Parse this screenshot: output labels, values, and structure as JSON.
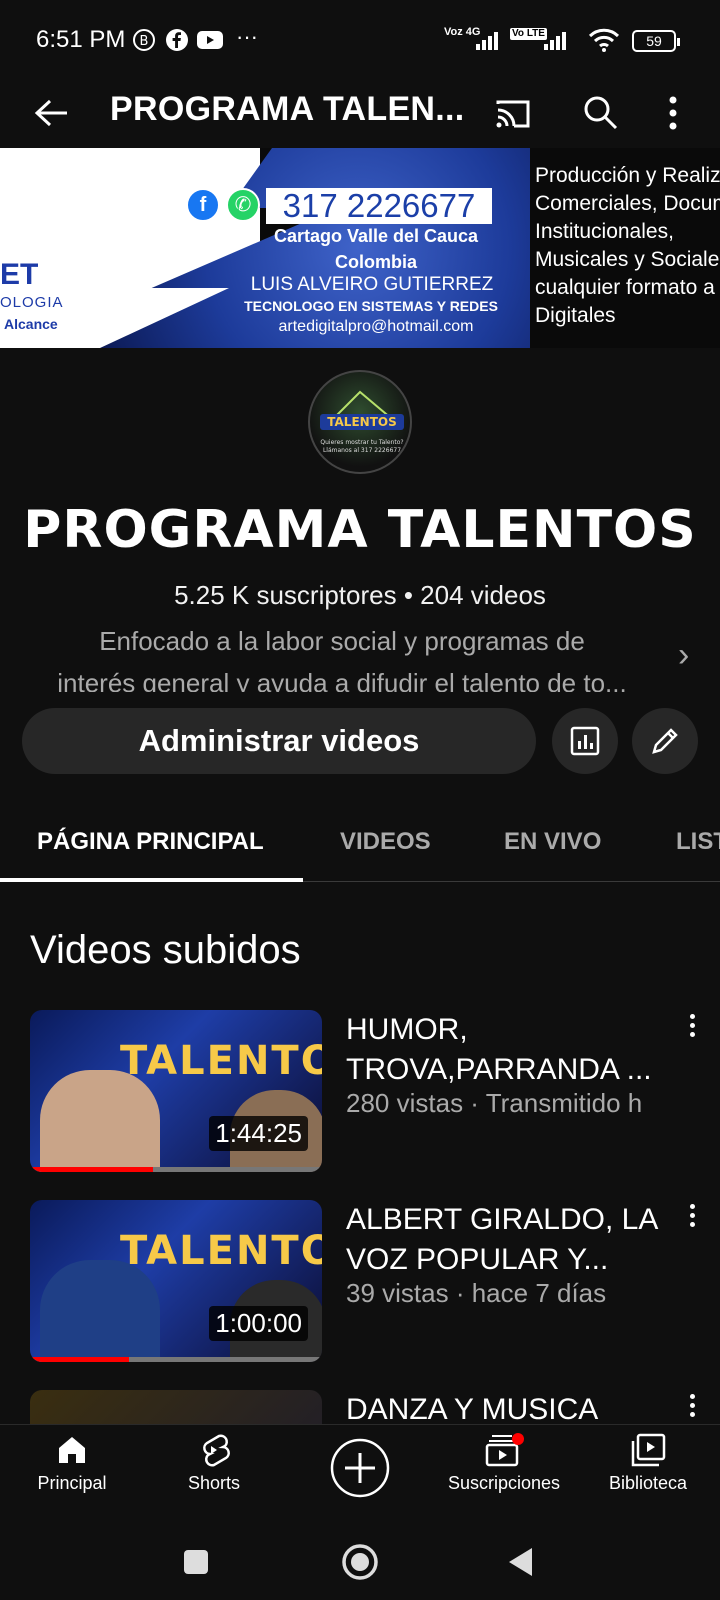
{
  "status_bar": {
    "time": "6:51 PM",
    "network_label_1": "Voz 4G",
    "network_label_2": "Vo LTE",
    "battery": "59"
  },
  "app_bar": {
    "title": "PROGRAMA TALEN..."
  },
  "banner": {
    "phone": "317 2226677",
    "location_1": "Cartago Valle del Cauca",
    "location_2": "Colombia",
    "person": "LUIS ALVEIRO GUTIERREZ",
    "role": "TECNOLOGO EN SISTEMAS Y REDES",
    "email": "artedigitalpro@hotmail.com",
    "logo_text": "ET",
    "logo_sub": "OLOGIA",
    "logo_sub2": "Alcance",
    "right_text": [
      "Producción y Realiza",
      "Comerciales, Docum",
      "Institucionales,",
      "Musicales y Sociale",
      "cualquier formato a",
      "Digitales"
    ]
  },
  "channel": {
    "name": "PROGRAMA TALENTOS",
    "stats": "5.25 K suscriptores • 204 videos",
    "description_1": "Enfocado a la labor social y programas de",
    "description_2": "interés general y ayuda a difudir el talento de to...",
    "manage_button": "Administrar videos"
  },
  "tabs": [
    "PÁGINA PRINCIPAL",
    "VIDEOS",
    "EN VIVO",
    "LIST"
  ],
  "section_title": "Videos subidos",
  "videos": [
    {
      "title": "HUMOR, TROVA,PARRANDA ...",
      "meta": "280 vistas · Transmitido h",
      "duration": "1:44:25",
      "thumb_text": "TALENTOS",
      "watched_fraction": 0.42
    },
    {
      "title": "ALBERT GIRALDO, LA VOZ POPULAR Y...",
      "meta": "39 vistas · hace 7 días",
      "duration": "1:00:00",
      "thumb_text": "TALENTOS",
      "watched_fraction": 0.34
    },
    {
      "title": "DANZA Y MUSICA",
      "meta": "",
      "duration": "",
      "thumb_text": "",
      "watched_fraction": 0
    }
  ],
  "bottom_nav": [
    {
      "label": "Principal",
      "icon": "home-icon"
    },
    {
      "label": "Shorts",
      "icon": "shorts-icon"
    },
    {
      "label": "",
      "icon": "create-icon"
    },
    {
      "label": "Suscripciones",
      "icon": "subscriptions-icon"
    },
    {
      "label": "Biblioteca",
      "icon": "library-icon"
    }
  ],
  "colors": {
    "background": "#0f0f0f",
    "accent_red": "#ff0000",
    "button_bg": "#272727",
    "secondary_text": "#aaaaaa"
  }
}
